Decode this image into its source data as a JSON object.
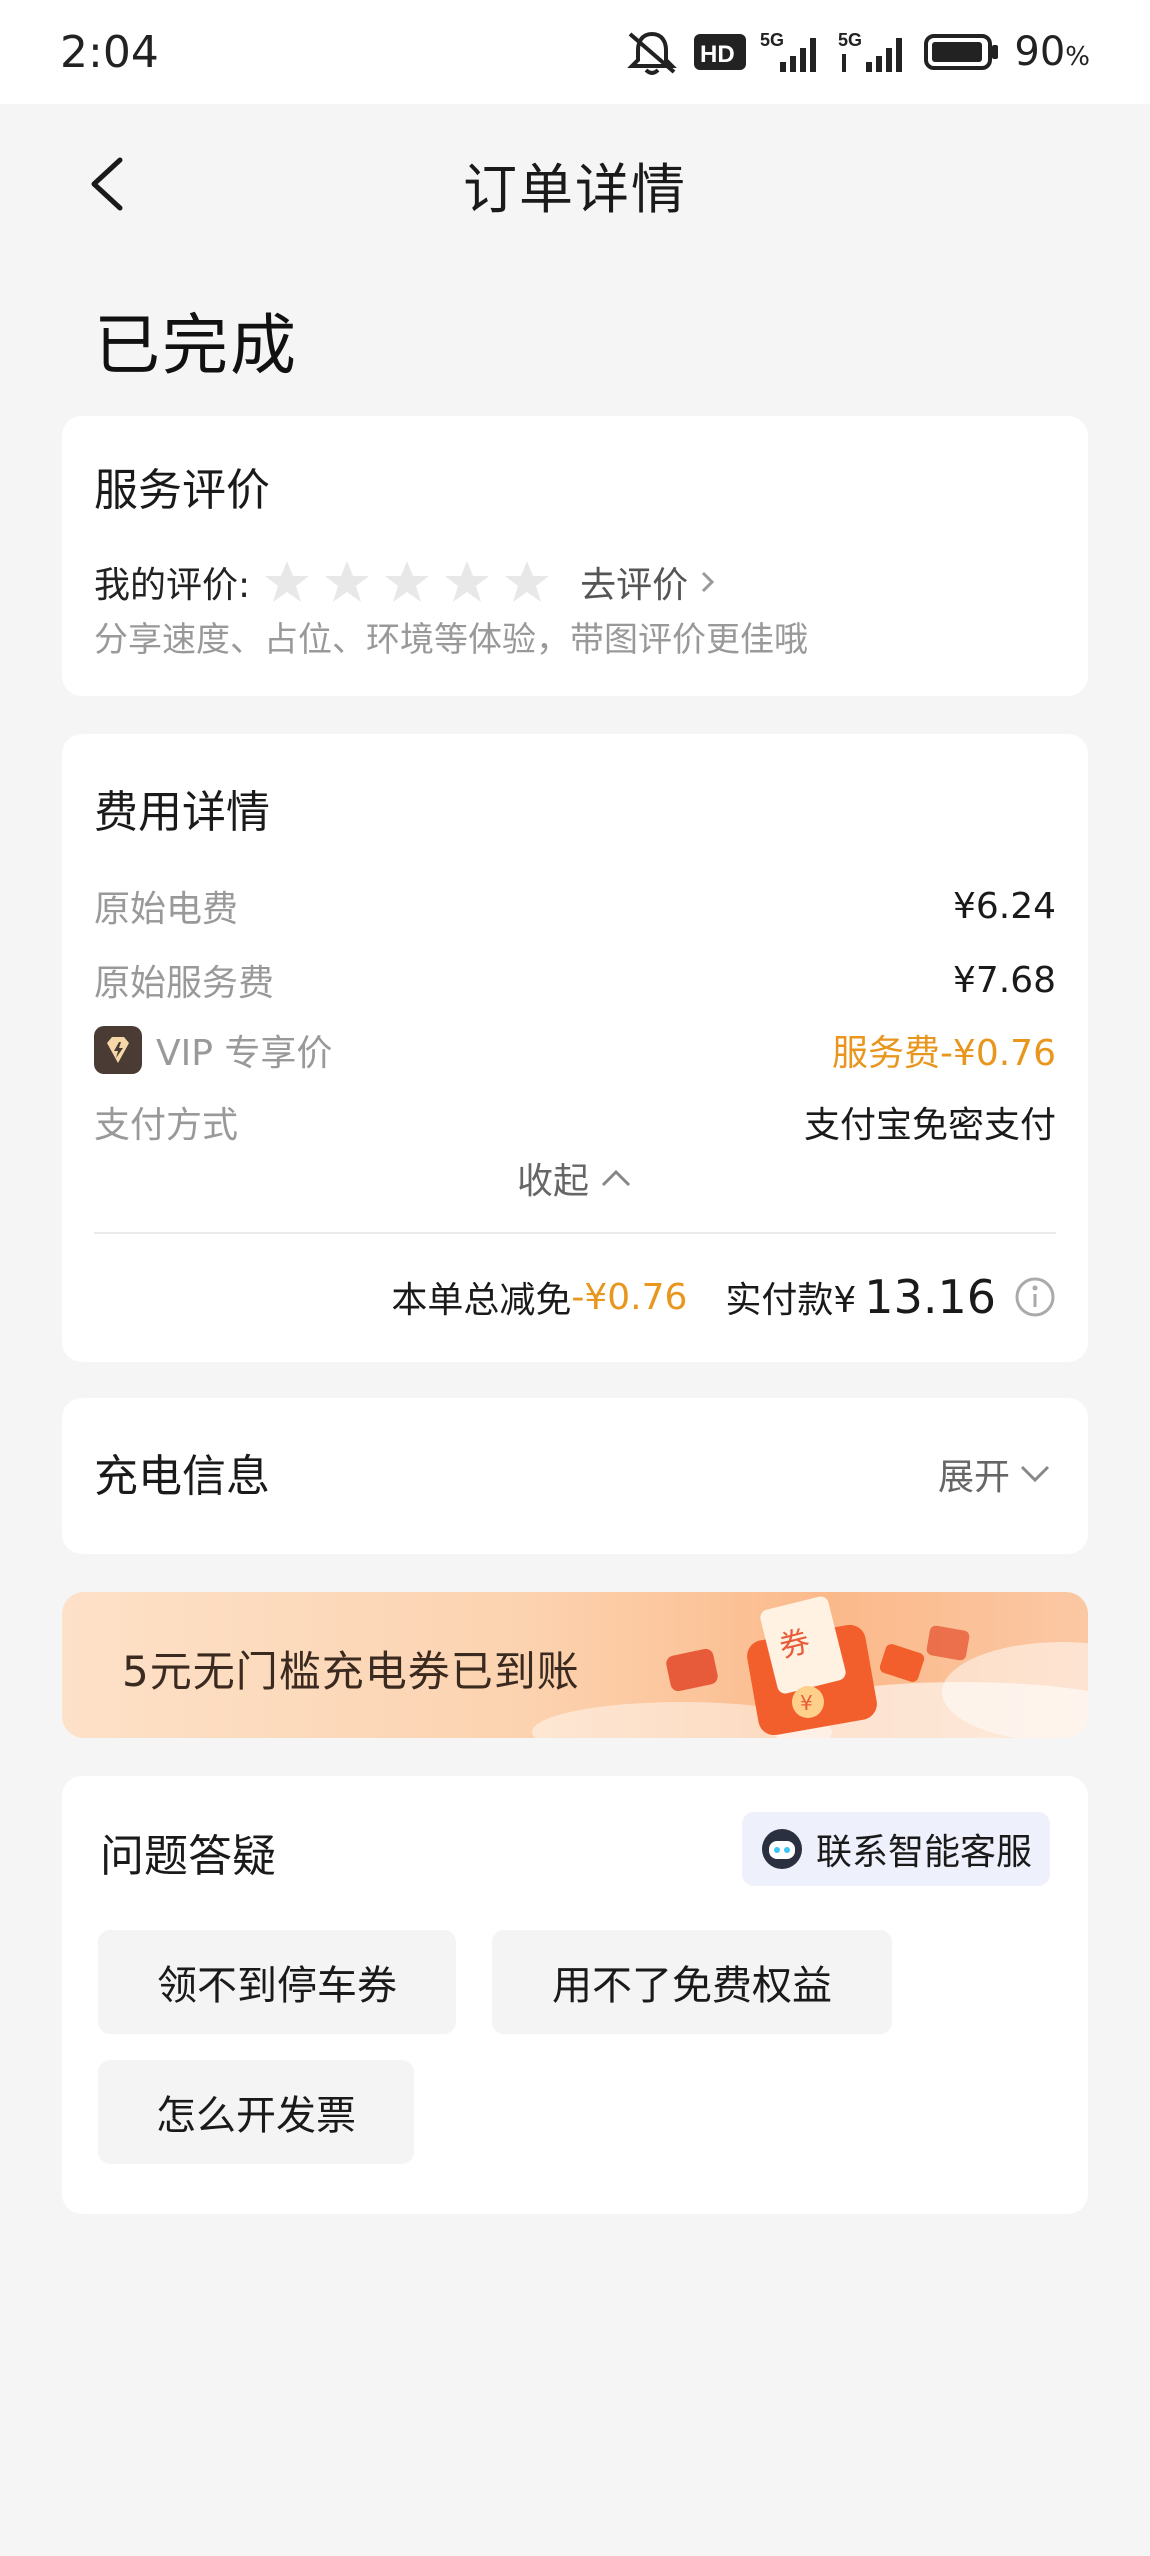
{
  "status_bar": {
    "time": "2:04",
    "network_1": "5G",
    "network_2": "5G",
    "hd_label": "HD",
    "battery_percent": "90",
    "battery_unit": "%"
  },
  "nav": {
    "title": "订单详情"
  },
  "order_status": "已完成",
  "rating": {
    "title": "服务评价",
    "my_rating_label": "我的评价:",
    "stars_filled": 0,
    "stars_total": 5,
    "go_rate_label": "去评价",
    "hint": "分享速度、占位、环境等体验，带图评价更佳哦"
  },
  "fees": {
    "title": "费用详情",
    "rows": [
      {
        "label": "原始电费",
        "value": "¥6.24"
      },
      {
        "label": "原始服务费",
        "value": "¥7.68"
      },
      {
        "label": "VIP 专享价",
        "value": "服务费-¥0.76"
      },
      {
        "label": "支付方式",
        "value": "支付宝免密支付"
      }
    ],
    "collapse_label": "收起",
    "total_discount_label": "本单总减免",
    "total_discount_value": "-¥0.76",
    "paid_label": "实付款¥",
    "paid_value": "13.16"
  },
  "charge_info": {
    "title": "充电信息",
    "expand_label": "展开"
  },
  "banner": {
    "text": "5元无门槛充电券已到账",
    "coupon_glyph": "券",
    "yen_glyph": "¥"
  },
  "faq": {
    "title": "问题答疑",
    "customer_service_label": "联系智能客服",
    "questions": [
      "领不到停车券",
      "用不了免费权益",
      "怎么开发票"
    ]
  },
  "colors": {
    "accent_orange": "#e8961e",
    "background": "#f5f5f5",
    "card": "#ffffff"
  }
}
